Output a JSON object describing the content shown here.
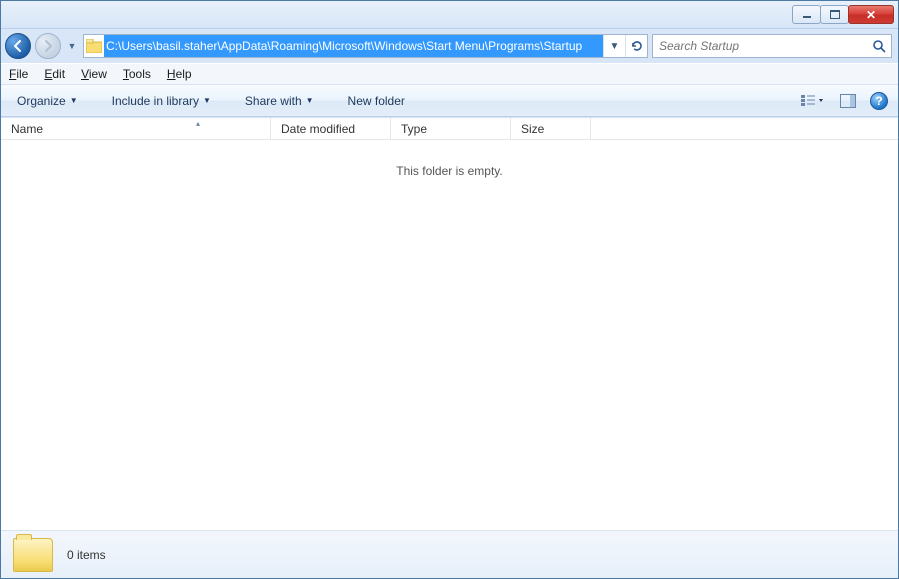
{
  "titlebar": {},
  "nav": {
    "address_path": "C:\\Users\\basil.staher\\AppData\\Roaming\\Microsoft\\Windows\\Start Menu\\Programs\\Startup",
    "search_placeholder": "Search Startup"
  },
  "menubar": {
    "file": "File",
    "edit": "Edit",
    "view": "View",
    "tools": "Tools",
    "help": "Help"
  },
  "toolbar": {
    "organize": "Organize",
    "include": "Include in library",
    "share": "Share with",
    "newfolder": "New folder"
  },
  "columns": {
    "name": "Name",
    "date": "Date modified",
    "type": "Type",
    "size": "Size"
  },
  "content": {
    "empty": "This folder is empty."
  },
  "status": {
    "count": "0 items"
  }
}
